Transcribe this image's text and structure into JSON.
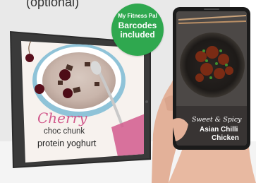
{
  "top_text": "(optional)",
  "badge": {
    "line1": "My Fitness Pal",
    "line2a": "Barcodes",
    "line2b": "included",
    "color": "#2fa84f"
  },
  "tablet_recipe": {
    "title_script": "Cherry",
    "line2": "choc chunk",
    "line3": "protein yoghurt",
    "accent_color": "#d25b8d"
  },
  "phone_recipe": {
    "line1": "Sweet & Spicy",
    "line2": "Asian Chilli",
    "line3": "Chicken"
  }
}
